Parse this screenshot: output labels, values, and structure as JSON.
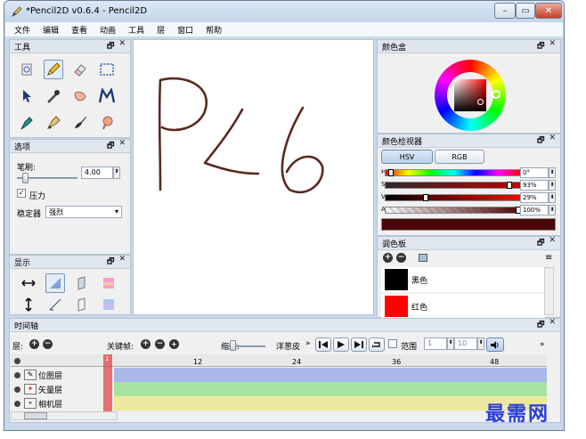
{
  "window": {
    "title": "*Pencil2D v0.6.4 - Pencil2D",
    "min_label": "–",
    "max_label": "▭",
    "close_label": "✕"
  },
  "menu": [
    "文件",
    "编辑",
    "查看",
    "动画",
    "工具",
    "层",
    "窗口",
    "帮助"
  ],
  "tools_panel": {
    "title": "工具",
    "float": "🗗",
    "close": "✕"
  },
  "options_panel": {
    "title": "选项",
    "float": "🗗",
    "close": "✕",
    "brush_label": "笔刷:",
    "brush_value": "4.00",
    "pressure_label": "压力",
    "pressure_checked": true,
    "stabilizer_label": "稳定器",
    "stabilizer_value": "强烈"
  },
  "display_panel": {
    "title": "显示",
    "float": "🗗",
    "close": "✕"
  },
  "color_box": {
    "title": "颜色盒",
    "float": "🗗",
    "close": "✕"
  },
  "color_inspector": {
    "title": "颜色检视器",
    "float": "🗗",
    "close": "✕",
    "hsv_label": "HSV",
    "rgb_label": "RGB",
    "h_label": "H",
    "h_value": "0°",
    "h_fraction": 0.02,
    "s_label": "S",
    "s_value": "93%",
    "s_fraction": 0.93,
    "v_label": "V",
    "v_value": "29%",
    "v_fraction": 0.29,
    "a_label": "A",
    "a_value": "100%",
    "a_fraction": 1.0,
    "preview_color": "#4a0606"
  },
  "palette": {
    "title": "调色板",
    "float": "🗗",
    "close": "✕",
    "items": [
      {
        "name": "黑色",
        "color": "#000000"
      },
      {
        "name": "红色",
        "color": "#ff0000"
      }
    ]
  },
  "timeline": {
    "title": "时间轴",
    "float": "🗗",
    "close": "✕",
    "layers_label": "层:",
    "keyframe_label": "关键帧:",
    "zoom_label": "缩放:",
    "onion_label": "洋葱皮",
    "more": "»",
    "range_label": "范围",
    "range_start": "1",
    "range_end": "10",
    "ticks": [
      "12",
      "24",
      "36",
      "48"
    ],
    "current_frame": "1",
    "overflow": "»",
    "layers": [
      {
        "name": "位图层",
        "color": "#aab8e8"
      },
      {
        "name": "矢量层",
        "color": "#a8e2a0"
      },
      {
        "name": "相机层",
        "color": "#ece8a0"
      }
    ]
  },
  "canvas": {
    "drawing_text": "P<6",
    "stroke_color": "#5a2a20"
  },
  "watermark": "最需网"
}
